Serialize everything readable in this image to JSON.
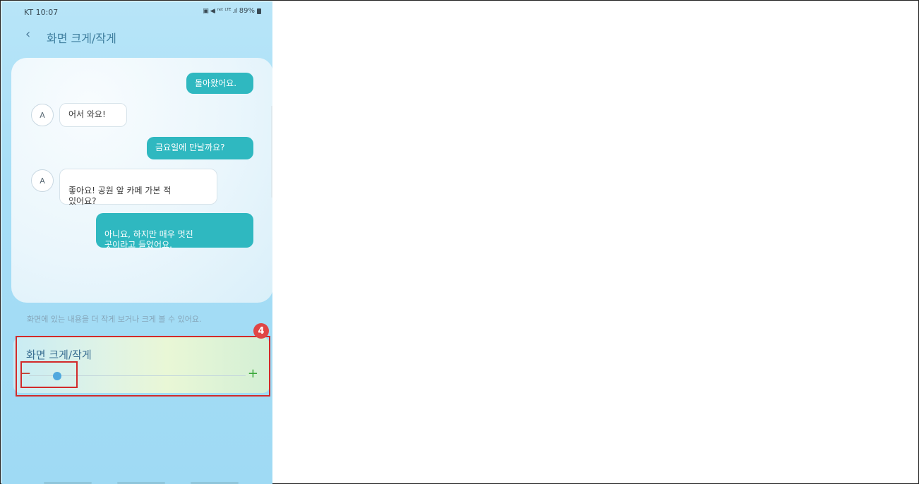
{
  "statusbar": {
    "carrier": "KT 10:07",
    "icons": "▣ ◀ᵢ ⁿᵉᵗ ᴸᵀᴱ .ıl",
    "battery": "89%"
  },
  "header": {
    "title": "화면 크게/작게"
  },
  "preview": {
    "messages": [
      {
        "side": "out",
        "text": "돌아왔어요."
      },
      {
        "side": "in",
        "avatar": "A",
        "text": "어서 와요!"
      },
      {
        "side": "out",
        "text": "금요일에 만날까요?"
      },
      {
        "side": "in",
        "avatar": "A",
        "text": "좋아요! 공원 앞 카페 가본 적\n있어요?"
      },
      {
        "side": "out",
        "text": "아니요, 하지만 매우 멋진\n곳이라고 들었어요."
      }
    ]
  },
  "description": "화면에 있는 내용을 더 작게 보거나 크게 볼 수 있어요.",
  "control": {
    "title": "화면 크게/작게",
    "level": 0.0
  },
  "badge": "4",
  "colors": {
    "accent": "#2fb8c0",
    "title": "#3a6f92",
    "highlight": "#d22a2a",
    "thumb": "#4fa8de"
  }
}
